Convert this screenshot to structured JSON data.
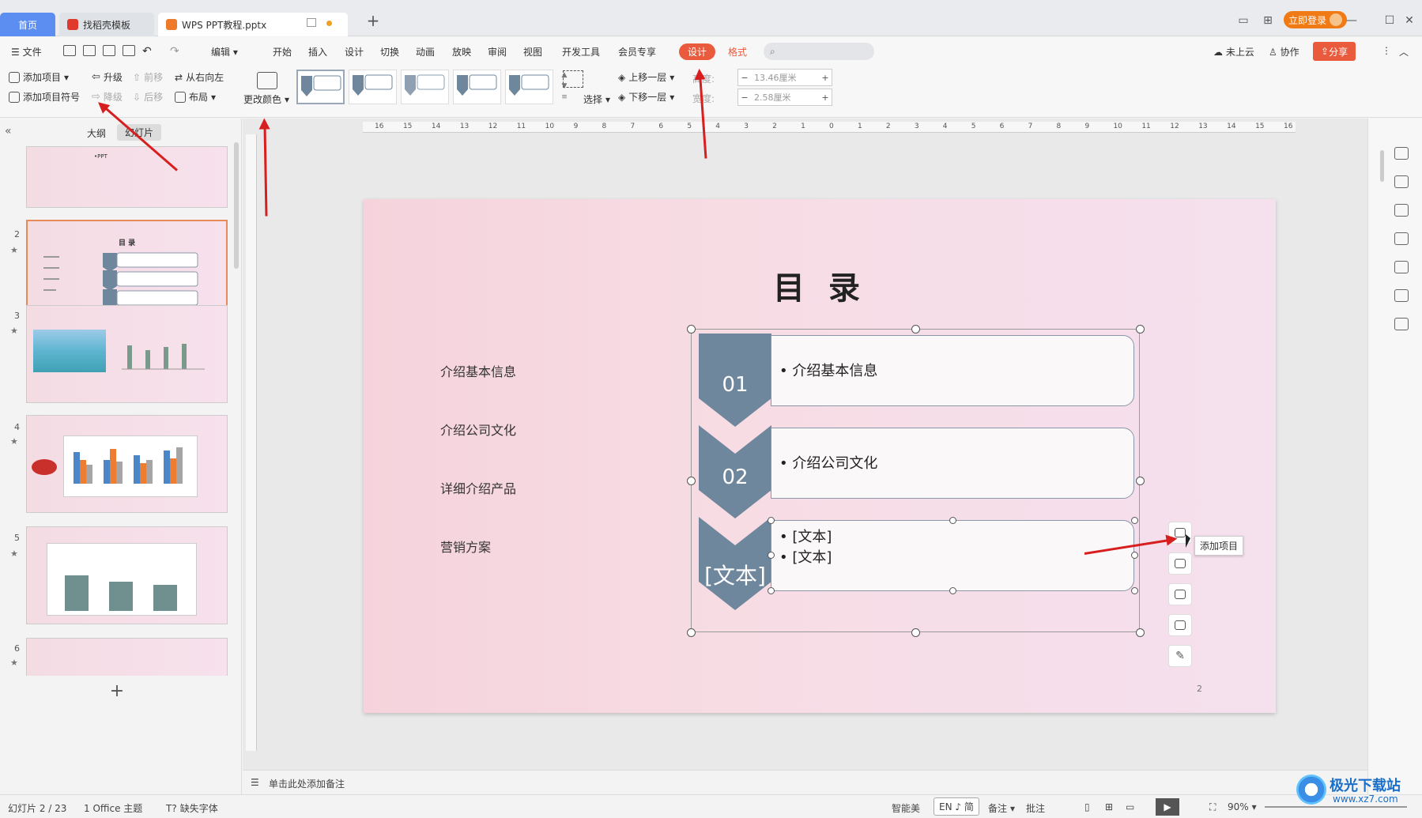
{
  "tabs": {
    "home": "首页",
    "tab2": "找稻壳模板",
    "tab3": "WPS PPT教程.pptx",
    "add": "+"
  },
  "menu": {
    "file": "文件",
    "edit": "编辑",
    "items": [
      "开始",
      "插入",
      "设计",
      "切换",
      "动画",
      "放映",
      "审阅",
      "视图",
      "开发工具",
      "会员专享"
    ],
    "design_tab": "设计",
    "format_tab": "格式",
    "cloud": "未上云",
    "collab": "协作",
    "share": "分享",
    "login": "立即登录"
  },
  "ribbon": {
    "add_item": "添加项目",
    "add_bullet": "添加项目符号",
    "upgrade": "升级",
    "downgrade": "降级",
    "move_forward": "前移",
    "move_back": "后移",
    "rtl": "从右向左",
    "layout": "布局",
    "change_color": "更改颜色",
    "select": "选择",
    "bring_forward": "上移一层",
    "send_backward": "下移一层",
    "height_label": "高度:",
    "height_value": "13.46厘米",
    "width_label": "宽度:",
    "width_value": "2.58厘米",
    "minus": "−",
    "plus": "+"
  },
  "panel": {
    "outline": "大纲",
    "slides": "幻灯片",
    "slide_nums": [
      "2",
      "3",
      "4",
      "5",
      "6"
    ],
    "thumb1_text": "•PPT",
    "thumb2_title": "目 录",
    "add_slide": "+"
  },
  "ruler": {
    "labels": [
      "16",
      "15",
      "14",
      "13",
      "12",
      "11",
      "10",
      "9",
      "8",
      "7",
      "6",
      "5",
      "4",
      "3",
      "2",
      "1",
      "0",
      "1",
      "2",
      "3",
      "4",
      "5",
      "6",
      "7",
      "8",
      "9",
      "10",
      "11",
      "12",
      "13",
      "14",
      "15",
      "16"
    ]
  },
  "slide": {
    "title": "目 录",
    "left_items": [
      "介绍基本信息",
      "介绍公司文化",
      "详细介绍产品",
      "营销方案"
    ],
    "rows": [
      {
        "num": "01",
        "text": "• 介绍基本信息"
      },
      {
        "num": "02",
        "text": "• 介绍公司文化"
      },
      {
        "num": "[文本]",
        "lines": [
          "• [文本]",
          "• [文本]"
        ]
      }
    ],
    "page_num": "2"
  },
  "float_tooltip": "添加项目",
  "notes": "单击此处添加备注",
  "status": {
    "slide_index": "幻灯片 2 / 23",
    "theme": "1 Office 主题",
    "missing_font": "缺失字体",
    "smart": "智能美",
    "ime": "EN ♪ 简",
    "notes": "备注",
    "comment": "批注",
    "zoom": "90%"
  },
  "watermark": {
    "name": "极光下载站",
    "url": "www.xz7.com"
  },
  "colors": {
    "accent": "#ea5a3c",
    "chevron": "#6f879d",
    "home_tab": "#5b8ef0",
    "arrow": "#d71f1f"
  }
}
